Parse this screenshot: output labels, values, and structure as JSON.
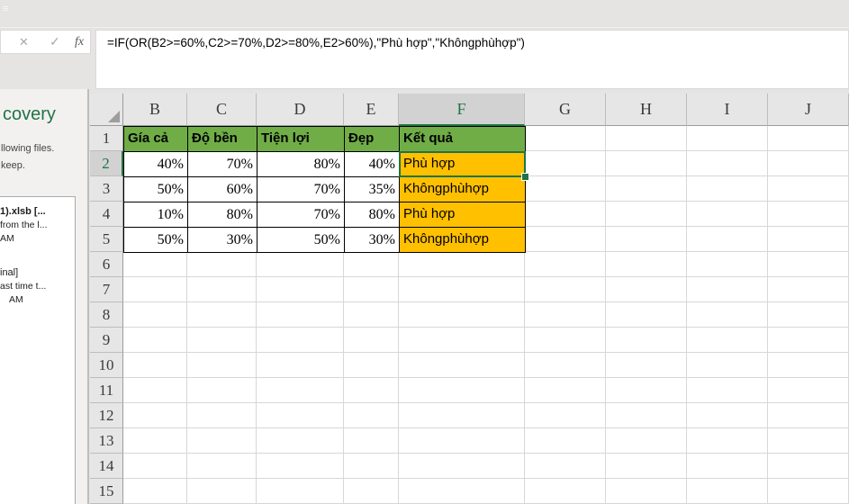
{
  "formula_bar": {
    "formula": "=IF(OR(B2>=60%,C2>=70%,D2>=80%,E2>60%),\"Phù hợp\",\"Khôngphùhợp\")",
    "cancel_label": "✕",
    "enter_label": "✓",
    "fx_label": "fx"
  },
  "recovery_pane": {
    "title_fragment": "covery",
    "desc_line1": "llowing files.",
    "desc_line2": "keep.",
    "files": [
      {
        "name": "1).xlsb  [...",
        "detail": "from the l...",
        "time": "AM"
      },
      {
        "name": "inal]",
        "detail": "ast time t...",
        "time": "AM"
      }
    ]
  },
  "grid": {
    "columns": [
      "B",
      "C",
      "D",
      "E",
      "F",
      "G",
      "H",
      "I",
      "J"
    ],
    "rows": [
      "1",
      "2",
      "3",
      "4",
      "5",
      "6",
      "7",
      "8",
      "9",
      "10",
      "11",
      "12",
      "13",
      "14",
      "15"
    ],
    "selected_column": "F",
    "selected_row": "2",
    "selected_cell": "F2",
    "table": {
      "headers": [
        "Gía cả",
        "Độ bền",
        "Tiện lợi",
        "Đẹp",
        "Kết quả"
      ],
      "rows": [
        [
          "40%",
          "70%",
          "80%",
          "40%",
          "Phù hợp"
        ],
        [
          "50%",
          "60%",
          "70%",
          "35%",
          "Khôngphùhợp"
        ],
        [
          "10%",
          "80%",
          "70%",
          "80%",
          "Phù hợp"
        ],
        [
          "50%",
          "30%",
          "50%",
          "30%",
          "Khôngphùhợp"
        ]
      ]
    }
  },
  "colors": {
    "header_fill": "#70AD47",
    "result_fill": "#FFC000",
    "selection": "#217346",
    "selected_header_bg": "#d2d2d2",
    "pane_title": "#217346"
  }
}
